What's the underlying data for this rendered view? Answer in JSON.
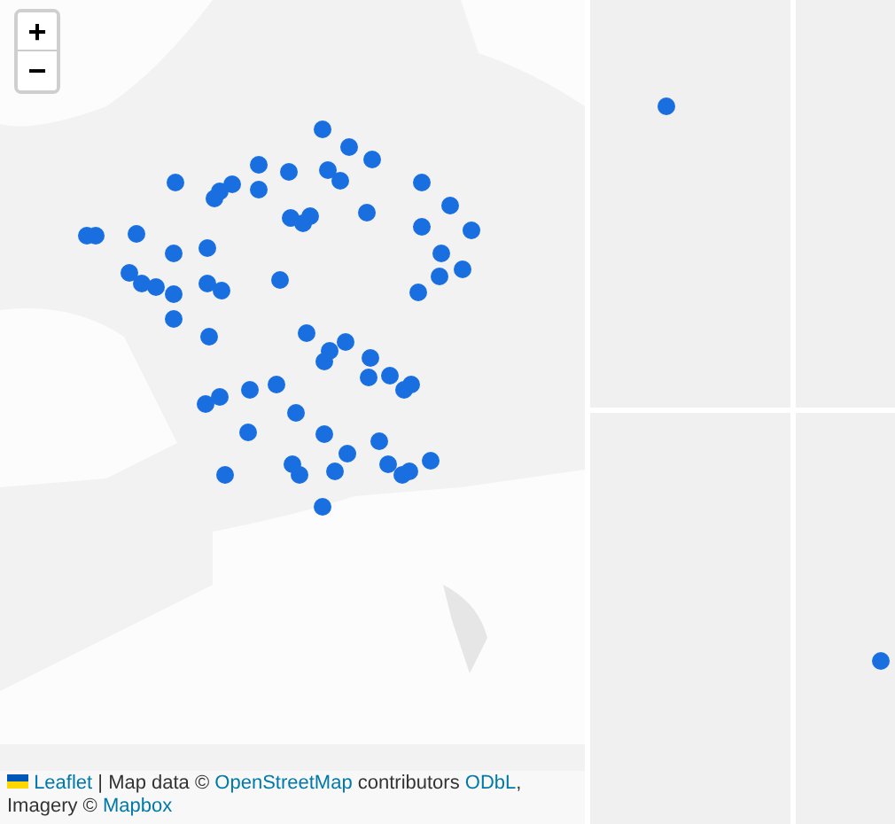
{
  "zoom_controls": [
    {
      "label": "+",
      "kind": "zoom-in"
    },
    {
      "label": "−",
      "kind": "zoom-out"
    }
  ],
  "attribution": {
    "leaflet": "Leaflet",
    "text_1": "| Map data ©",
    "osm": "OpenStreetMap",
    "text_2": "contributors",
    "odbl": "ODbL",
    "text_3": ", Imagery ©",
    "mapbox": "Mapbox"
  }
}
